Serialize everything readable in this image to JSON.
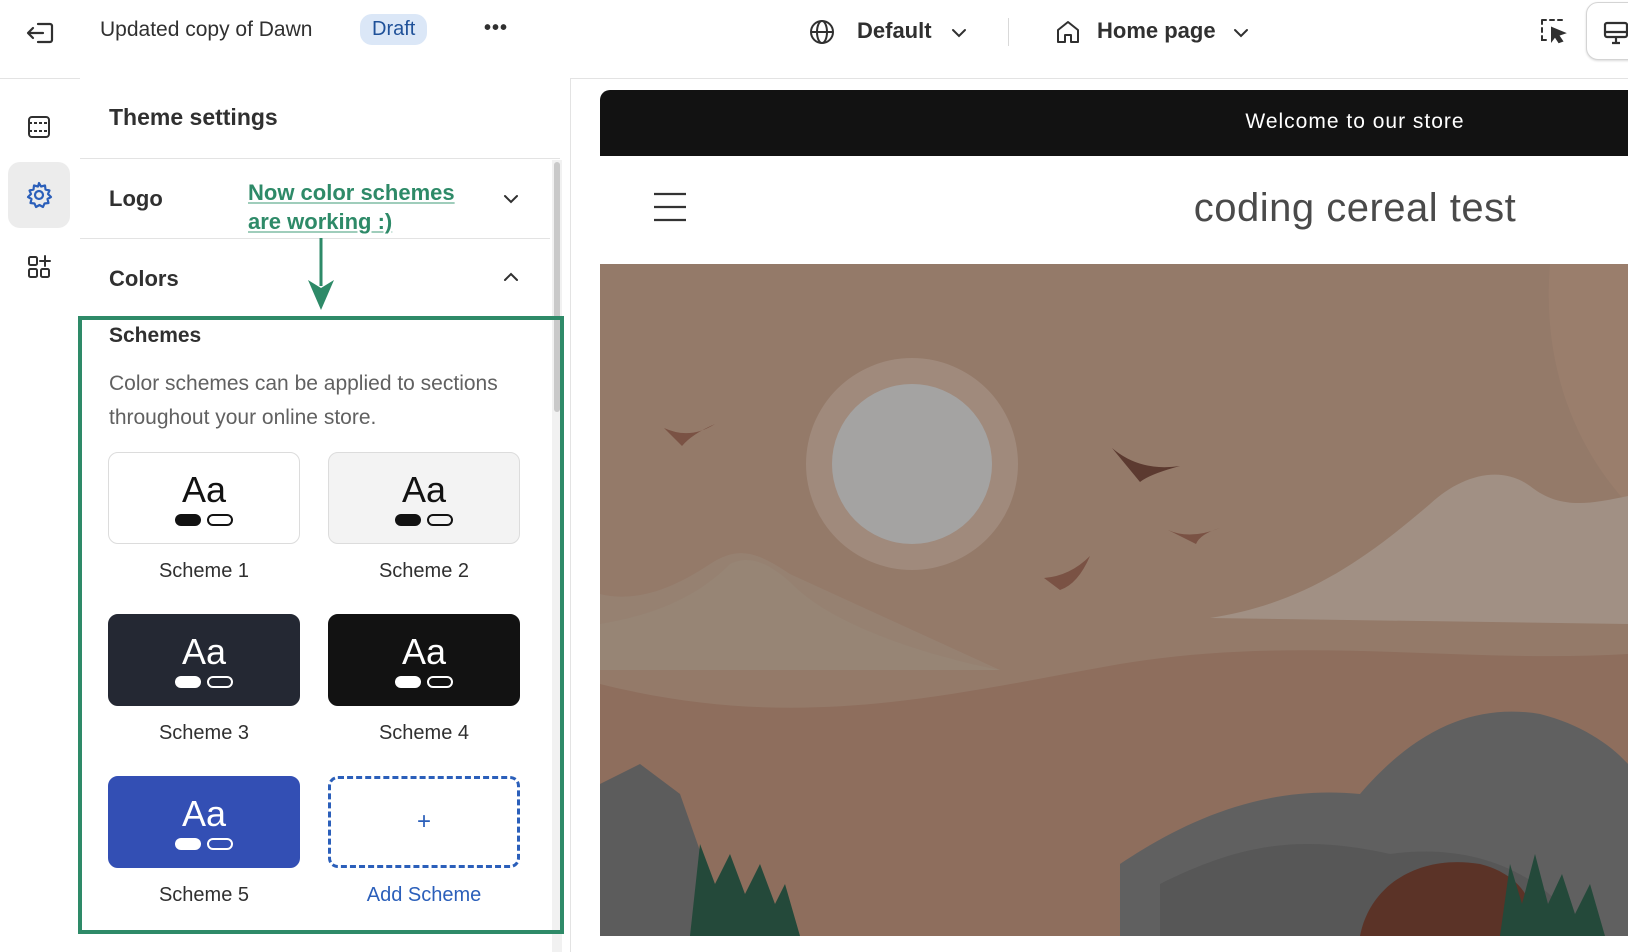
{
  "topbar": {
    "theme_name": "Updated copy of Dawn",
    "status_badge": "Draft",
    "more_label": "•••",
    "locale_label": "Default",
    "page_label": "Home page"
  },
  "panel": {
    "title": "Theme settings",
    "sections": {
      "logo": "Logo",
      "colors": "Colors"
    },
    "schemes": {
      "title": "Schemes",
      "description": "Color schemes can be applied to sections throughout your online store.",
      "items": [
        {
          "label": "Scheme 1",
          "sample": "Aa",
          "bg": "#ffffff",
          "fg": "#121212"
        },
        {
          "label": "Scheme 2",
          "sample": "Aa",
          "bg": "#f3f3f3",
          "fg": "#121212"
        },
        {
          "label": "Scheme 3",
          "sample": "Aa",
          "bg": "#242833",
          "fg": "#ffffff"
        },
        {
          "label": "Scheme 4",
          "sample": "Aa",
          "bg": "#121212",
          "fg": "#ffffff"
        },
        {
          "label": "Scheme 5",
          "sample": "Aa",
          "bg": "#334fb4",
          "fg": "#ffffff"
        }
      ],
      "add_label": "Add Scheme",
      "add_symbol": "+"
    }
  },
  "annotation": {
    "text": "Now color schemes are working :)",
    "color": "#2e8a68"
  },
  "preview": {
    "announcement": "Welcome to our store",
    "store_name": "coding cereal test"
  },
  "colors": {
    "accent": "#2b5fba",
    "annotation": "#2e8a68",
    "hero_bg": "#947a69"
  }
}
